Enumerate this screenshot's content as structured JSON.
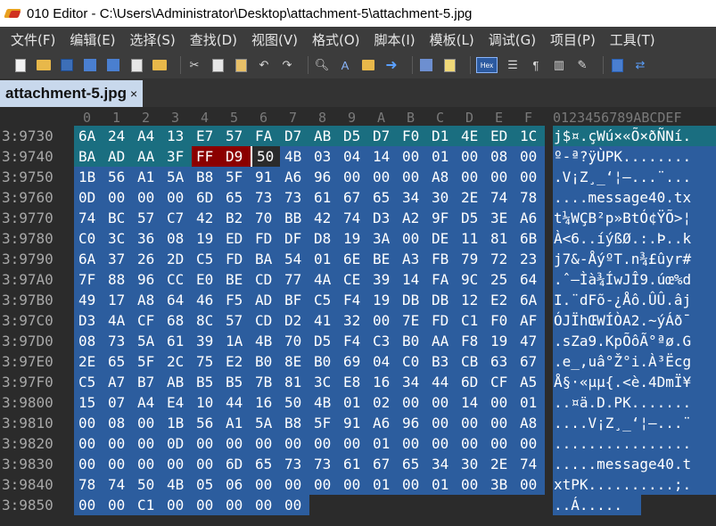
{
  "window": {
    "title": "010 Editor - C:\\Users\\Administrator\\Desktop\\attachment-5\\attachment-5.jpg"
  },
  "menu": [
    "文件(F)",
    "编辑(E)",
    "选择(S)",
    "查找(D)",
    "视图(V)",
    "格式(O)",
    "脚本(I)",
    "模板(L)",
    "调试(G)",
    "项目(P)",
    "工具(T)"
  ],
  "toolbar": {
    "icons": [
      "new-file-icon",
      "open-folder-icon",
      "save-icon",
      "save-as-icon",
      "save-all-icon",
      "close-file-icon",
      "open-folder-icon",
      "cut-icon",
      "copy-icon",
      "paste-icon",
      "undo-icon",
      "redo-icon",
      "find-icon",
      "replace-icon",
      "find-in-files-icon",
      "goto-icon",
      "compare-icon",
      "template-icon",
      "hex-mode-icon",
      "inspector-icon",
      "paragraph-icon",
      "columns-icon",
      "highlight-icon",
      "calculator-icon",
      "arrows-icon"
    ],
    "hex_label": "Hex"
  },
  "tab": {
    "label": "attachment-5.jpg",
    "close": "×"
  },
  "colors": {
    "selection": "#2c5d9e",
    "selection_first": "#1a6e80",
    "marker": "#8b0000",
    "background": "#2b2b2b"
  },
  "hex_header": [
    "0",
    "1",
    "2",
    "3",
    "4",
    "5",
    "6",
    "7",
    "8",
    "9",
    "A",
    "B",
    "C",
    "D",
    "E",
    "F"
  ],
  "ascii_header": "0123456789ABCDEF",
  "rows": [
    {
      "addr": "3:9730",
      "bytes": [
        "6A",
        "24",
        "A4",
        "13",
        "E7",
        "57",
        "FA",
        "D7",
        "AB",
        "D5",
        "D7",
        "F0",
        "D1",
        "4E",
        "ED",
        "1C"
      ],
      "ascii": "j$¤.çWú×«Õ×ðÑNí."
    },
    {
      "addr": "3:9740",
      "bytes": [
        "BA",
        "AD",
        "AA",
        "3F",
        "FF",
        "D9",
        "50",
        "4B",
        "03",
        "04",
        "14",
        "00",
        "01",
        "00",
        "08",
        "00"
      ],
      "ascii": "º-ª?ÿÙPK........"
    },
    {
      "addr": "3:9750",
      "bytes": [
        "1B",
        "56",
        "A1",
        "5A",
        "B8",
        "5F",
        "91",
        "A6",
        "96",
        "00",
        "00",
        "00",
        "A8",
        "00",
        "00",
        "00"
      ],
      "ascii": ".V¡Z¸_‘¦–...¨..."
    },
    {
      "addr": "3:9760",
      "bytes": [
        "0D",
        "00",
        "00",
        "00",
        "6D",
        "65",
        "73",
        "73",
        "61",
        "67",
        "65",
        "34",
        "30",
        "2E",
        "74",
        "78"
      ],
      "ascii": "....message40.tx"
    },
    {
      "addr": "3:9770",
      "bytes": [
        "74",
        "BC",
        "57",
        "C7",
        "42",
        "B2",
        "70",
        "BB",
        "42",
        "74",
        "D3",
        "A2",
        "9F",
        "D5",
        "3E",
        "A6"
      ],
      "ascii": "t¼WÇB²p»BtÓ¢ŸÕ>¦"
    },
    {
      "addr": "3:9780",
      "bytes": [
        "C0",
        "3C",
        "36",
        "08",
        "19",
        "ED",
        "FD",
        "DF",
        "D8",
        "19",
        "3A",
        "00",
        "DE",
        "11",
        "81",
        "6B"
      ],
      "ascii": "À<6..íýßØ.:.Þ..k"
    },
    {
      "addr": "3:9790",
      "bytes": [
        "6A",
        "37",
        "26",
        "2D",
        "C5",
        "FD",
        "BA",
        "54",
        "01",
        "6E",
        "BE",
        "A3",
        "FB",
        "79",
        "72",
        "23"
      ],
      "ascii": "j7&-ÅýºT.n¾£ûyr#"
    },
    {
      "addr": "3:97A0",
      "bytes": [
        "7F",
        "88",
        "96",
        "CC",
        "E0",
        "BE",
        "CD",
        "77",
        "4A",
        "CE",
        "39",
        "14",
        "FA",
        "9C",
        "25",
        "64"
      ],
      "ascii": ".ˆ–Ìà¾ÍwJÎ9.úœ%d"
    },
    {
      "addr": "3:97B0",
      "bytes": [
        "49",
        "17",
        "A8",
        "64",
        "46",
        "F5",
        "AD",
        "BF",
        "C5",
        "F4",
        "19",
        "DB",
        "DB",
        "12",
        "E2",
        "6A"
      ],
      "ascii": "I.¨dFõ-¿Åô.ÛÛ.âj"
    },
    {
      "addr": "3:97C0",
      "bytes": [
        "D3",
        "4A",
        "CF",
        "68",
        "8C",
        "57",
        "CD",
        "D2",
        "41",
        "32",
        "00",
        "7E",
        "FD",
        "C1",
        "F0",
        "AF"
      ],
      "ascii": "ÓJÏhŒWÍÒA2.~ýÁð¯"
    },
    {
      "addr": "3:97D0",
      "bytes": [
        "08",
        "73",
        "5A",
        "61",
        "39",
        "1A",
        "4B",
        "70",
        "D5",
        "F4",
        "C3",
        "B0",
        "AA",
        "F8",
        "19",
        "47"
      ],
      "ascii": ".sZa9.KpÕôÃ°ªø.G"
    },
    {
      "addr": "3:97E0",
      "bytes": [
        "2E",
        "65",
        "5F",
        "2C",
        "75",
        "E2",
        "B0",
        "8E",
        "B0",
        "69",
        "04",
        "C0",
        "B3",
        "CB",
        "63",
        "67"
      ],
      "ascii": ".e_,uâ°Ž°i.À³Ëcg"
    },
    {
      "addr": "3:97F0",
      "bytes": [
        "C5",
        "A7",
        "B7",
        "AB",
        "B5",
        "B5",
        "7B",
        "81",
        "3C",
        "E8",
        "16",
        "34",
        "44",
        "6D",
        "CF",
        "A5"
      ],
      "ascii": "Å§·«µµ{.<è.4DmÏ¥"
    },
    {
      "addr": "3:9800",
      "bytes": [
        "15",
        "07",
        "A4",
        "E4",
        "10",
        "44",
        "16",
        "50",
        "4B",
        "01",
        "02",
        "00",
        "00",
        "14",
        "00",
        "01"
      ],
      "ascii": "..¤ä.D.PK......."
    },
    {
      "addr": "3:9810",
      "bytes": [
        "00",
        "08",
        "00",
        "1B",
        "56",
        "A1",
        "5A",
        "B8",
        "5F",
        "91",
        "A6",
        "96",
        "00",
        "00",
        "00",
        "A8"
      ],
      "ascii": "....V¡Z¸_‘¦–...¨"
    },
    {
      "addr": "3:9820",
      "bytes": [
        "00",
        "00",
        "00",
        "0D",
        "00",
        "00",
        "00",
        "00",
        "00",
        "00",
        "01",
        "00",
        "00",
        "00",
        "00",
        "00"
      ],
      "ascii": "................"
    },
    {
      "addr": "3:9830",
      "bytes": [
        "00",
        "00",
        "00",
        "00",
        "00",
        "6D",
        "65",
        "73",
        "73",
        "61",
        "67",
        "65",
        "34",
        "30",
        "2E",
        "74"
      ],
      "ascii": ".....message40.t"
    },
    {
      "addr": "3:9840",
      "bytes": [
        "78",
        "74",
        "50",
        "4B",
        "05",
        "06",
        "00",
        "00",
        "00",
        "00",
        "01",
        "00",
        "01",
        "00",
        "3B",
        "00"
      ],
      "ascii": "xtPK..........;."
    },
    {
      "addr": "3:9850",
      "bytes": [
        "00",
        "00",
        "C1",
        "00",
        "00",
        "00",
        "00",
        "00"
      ],
      "ascii": "..Á....."
    }
  ]
}
